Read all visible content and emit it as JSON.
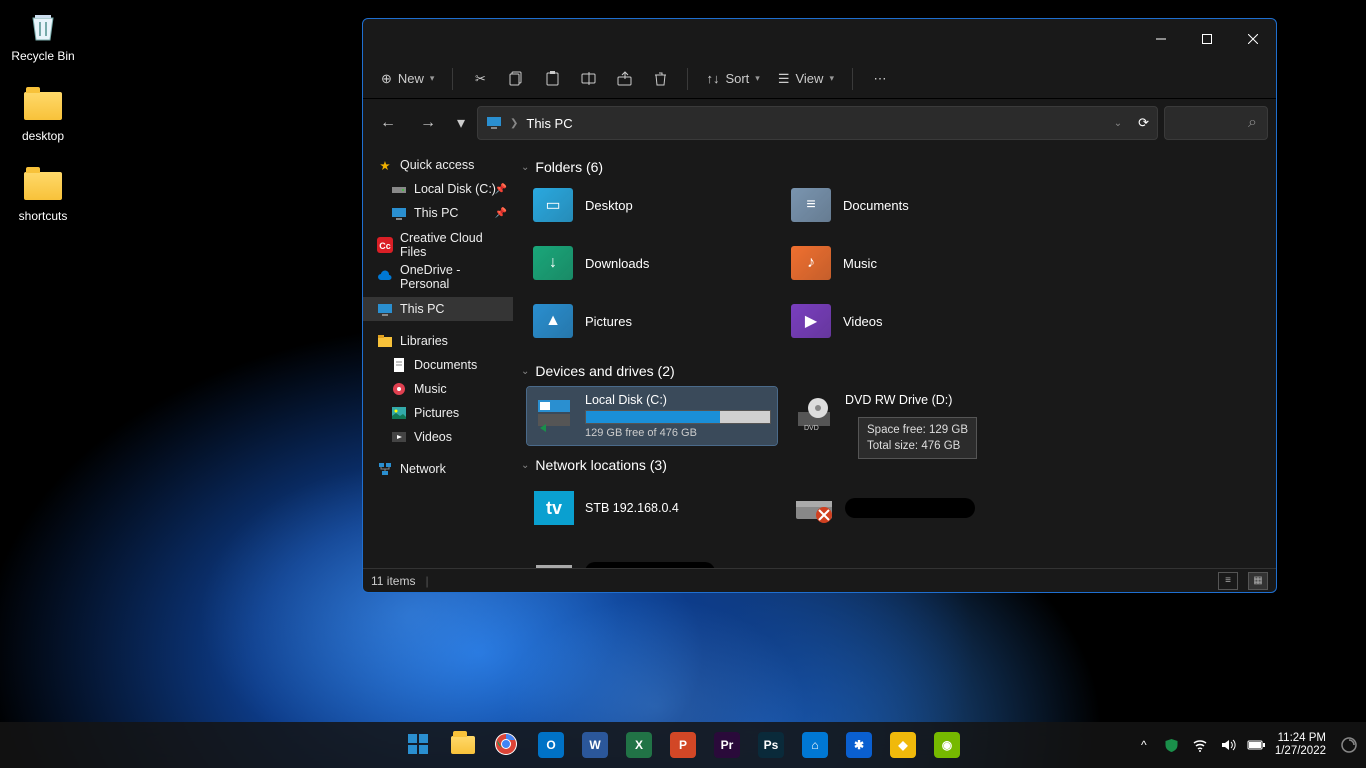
{
  "desktop_icons": [
    {
      "name": "recycle-bin",
      "label": "Recycle Bin"
    },
    {
      "name": "desktop-folder",
      "label": "desktop"
    },
    {
      "name": "shortcuts-folder",
      "label": "shortcuts"
    }
  ],
  "explorer": {
    "toolbar": {
      "new_label": "New",
      "sort_label": "Sort",
      "view_label": "View"
    },
    "address": {
      "location": "This PC"
    },
    "sidebar": {
      "items": [
        {
          "label": "Quick access",
          "icon": "star",
          "level": 0
        },
        {
          "label": "Local Disk (C:)",
          "icon": "drive",
          "level": 1,
          "pinned": true
        },
        {
          "label": "This PC",
          "icon": "pc",
          "level": 1,
          "pinned": true
        },
        {
          "label": "Creative Cloud Files",
          "icon": "cc",
          "level": 0
        },
        {
          "label": "OneDrive - Personal",
          "icon": "cloud",
          "level": 0
        },
        {
          "label": "This PC",
          "icon": "pc",
          "level": 0,
          "selected": true
        },
        {
          "label": "Libraries",
          "icon": "lib",
          "level": 0
        },
        {
          "label": "Documents",
          "icon": "doc",
          "level": 1
        },
        {
          "label": "Music",
          "icon": "music",
          "level": 1
        },
        {
          "label": "Pictures",
          "icon": "pic",
          "level": 1
        },
        {
          "label": "Videos",
          "icon": "vid",
          "level": 1
        },
        {
          "label": "Network",
          "icon": "net",
          "level": 0
        }
      ]
    },
    "groups": {
      "folders_header": "Folders (6)",
      "folders": [
        {
          "label": "Desktop",
          "color": "#2aa9e0"
        },
        {
          "label": "Documents",
          "color": "#7a95b0"
        },
        {
          "label": "Downloads",
          "color": "#1aa77a"
        },
        {
          "label": "Music",
          "color": "#f07030"
        },
        {
          "label": "Pictures",
          "color": "#2a8fd0"
        },
        {
          "label": "Videos",
          "color": "#7a3fbf"
        }
      ],
      "drives_header": "Devices and drives (2)",
      "drives": [
        {
          "label": "Local Disk (C:)",
          "free": "129 GB free of 476 GB",
          "used_pct": 73,
          "selected": true,
          "type": "hdd"
        },
        {
          "label": "DVD RW Drive (D:)",
          "type": "dvd"
        }
      ],
      "network_header": "Network locations (3)",
      "network": [
        {
          "label": "STB 192.168.0.4",
          "type": "tv"
        },
        {
          "label": "",
          "type": "offline",
          "redacted": true
        },
        {
          "label": "",
          "type": "offline",
          "redacted": true
        }
      ]
    },
    "tooltip": {
      "line1": "Space free: 129 GB",
      "line2": "Total size: 476 GB"
    },
    "statusbar": {
      "count": "11 items"
    }
  },
  "taskbar": {
    "apps": [
      {
        "name": "start",
        "bg": "",
        "label": "⊞"
      },
      {
        "name": "explorer",
        "bg": "#f8c23a"
      },
      {
        "name": "chrome",
        "bg": "#fff"
      },
      {
        "name": "outlook",
        "bg": "#0072c6",
        "label": "O"
      },
      {
        "name": "word",
        "bg": "#2b579a",
        "label": "W"
      },
      {
        "name": "excel",
        "bg": "#217346",
        "label": "X"
      },
      {
        "name": "powerpoint",
        "bg": "#d24726",
        "label": "P"
      },
      {
        "name": "premiere",
        "bg": "#2a0a3a",
        "label": "Pr"
      },
      {
        "name": "photoshop",
        "bg": "#0a2a3a",
        "label": "Ps"
      },
      {
        "name": "store",
        "bg": "#0078d4",
        "label": "⌂"
      },
      {
        "name": "bluetooth",
        "bg": "#0a5fd0",
        "label": "✱"
      },
      {
        "name": "binance",
        "bg": "#f0b90b",
        "label": "◆"
      },
      {
        "name": "nvidia",
        "bg": "#76b900",
        "label": "◉"
      }
    ],
    "time": "11:24 PM",
    "date": "1/27/2022"
  }
}
